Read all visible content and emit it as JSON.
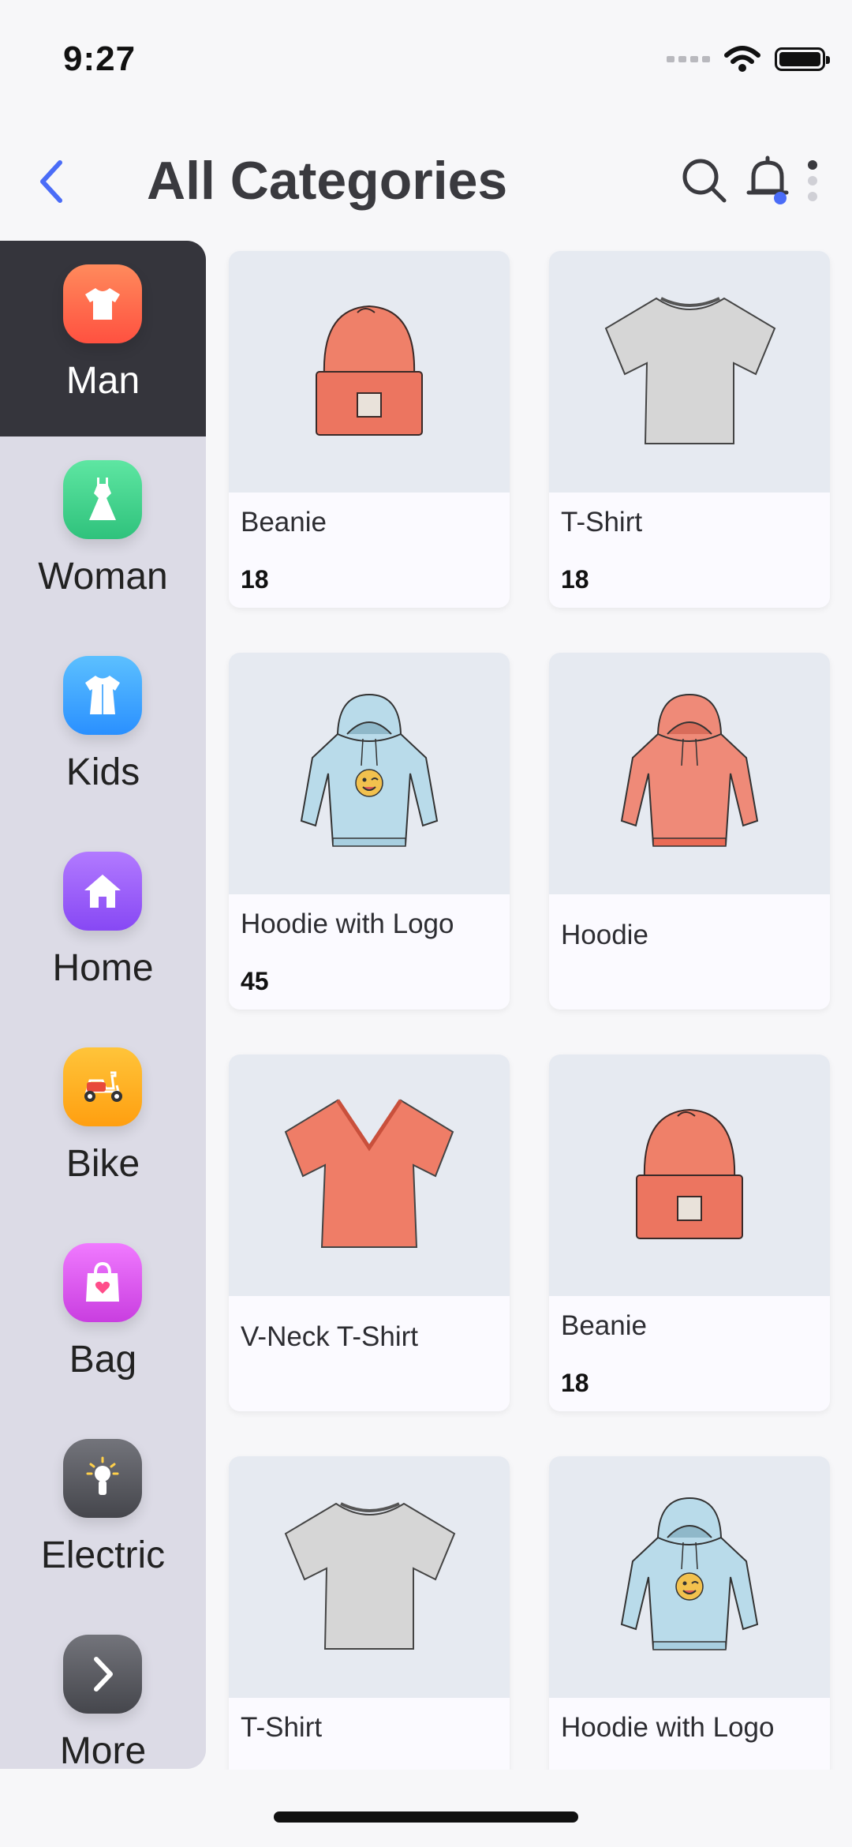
{
  "status": {
    "time": "9:27"
  },
  "header": {
    "title": "All Categories",
    "back_icon": "chevron-left-icon",
    "search_icon": "search-icon",
    "bell_icon": "bell-icon",
    "more_icon": "more-vertical-icon",
    "accent": "#4a6cf7"
  },
  "sidebar": {
    "items": [
      {
        "label": "Man",
        "icon": "tshirt-icon",
        "color": "#ff6b4e",
        "active": true
      },
      {
        "label": "Woman",
        "icon": "dress-icon",
        "color": "#3fd48a"
      },
      {
        "label": "Kids",
        "icon": "kids-clothes-icon",
        "color": "#3aa8ff"
      },
      {
        "label": "Home",
        "icon": "house-icon",
        "color": "#9b5cff"
      },
      {
        "label": "Bike",
        "icon": "scooter-icon",
        "color": "#ffb21c"
      },
      {
        "label": "Bag",
        "icon": "shopping-bag-icon",
        "color": "#e04fe8"
      },
      {
        "label": "Electric",
        "icon": "lightbulb-icon",
        "color": "#56575e"
      },
      {
        "label": "More",
        "icon": "chevron-right-icon",
        "color": "#56575e"
      }
    ]
  },
  "products": [
    {
      "name": "Beanie",
      "count": "18",
      "image": "beanie-red"
    },
    {
      "name": "T-Shirt",
      "count": "18",
      "image": "tshirt-gray"
    },
    {
      "name": "Hoodie with Logo",
      "count": "45",
      "image": "hoodie-blue-logo"
    },
    {
      "name": "Hoodie",
      "count": "",
      "image": "hoodie-red"
    },
    {
      "name": "V-Neck T-Shirt",
      "count": "",
      "image": "vneck-red"
    },
    {
      "name": "Beanie",
      "count": "18",
      "image": "beanie-red"
    },
    {
      "name": "T-Shirt",
      "count": "",
      "image": "tshirt-gray"
    },
    {
      "name": "Hoodie with Logo",
      "count": "",
      "image": "hoodie-blue-logo"
    }
  ]
}
